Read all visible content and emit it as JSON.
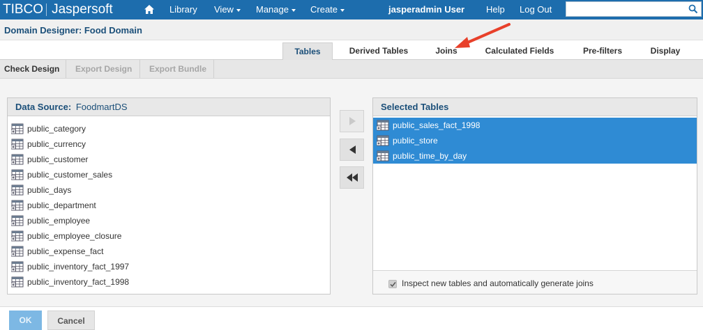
{
  "header": {
    "logo_tibco": "TIBCO",
    "logo_product": "Jaspersoft",
    "nav": {
      "library": "Library",
      "view": "View",
      "manage": "Manage",
      "create": "Create"
    },
    "user": "jasperadmin User",
    "help": "Help",
    "logout": "Log Out",
    "search_value": ""
  },
  "page": {
    "title": "Domain Designer: Food Domain"
  },
  "tabs": [
    {
      "label": "Tables",
      "active": true
    },
    {
      "label": "Derived Tables",
      "active": false
    },
    {
      "label": "Joins",
      "active": false
    },
    {
      "label": "Calculated Fields",
      "active": false
    },
    {
      "label": "Pre-filters",
      "active": false
    },
    {
      "label": "Display",
      "active": false
    }
  ],
  "toolbar": {
    "check_design": "Check Design",
    "export_design": "Export Design",
    "export_bundle": "Export Bundle"
  },
  "left_panel": {
    "label": "Data Source:",
    "data_source": "FoodmartDS",
    "items": [
      "public_category",
      "public_currency",
      "public_customer",
      "public_customer_sales",
      "public_days",
      "public_department",
      "public_employee",
      "public_employee_closure",
      "public_expense_fact",
      "public_inventory_fact_1997",
      "public_inventory_fact_1998"
    ]
  },
  "right_panel": {
    "title": "Selected Tables",
    "items": [
      "public_sales_fact_1998",
      "public_store",
      "public_time_by_day"
    ],
    "inspect_label": "Inspect new tables and automatically generate joins",
    "inspect_checked": true
  },
  "buttons": {
    "ok": "OK",
    "cancel": "Cancel"
  },
  "colors": {
    "header_bg": "#1d6dad",
    "selection": "#2f8bd4",
    "annotation_arrow": "#e8402a"
  }
}
